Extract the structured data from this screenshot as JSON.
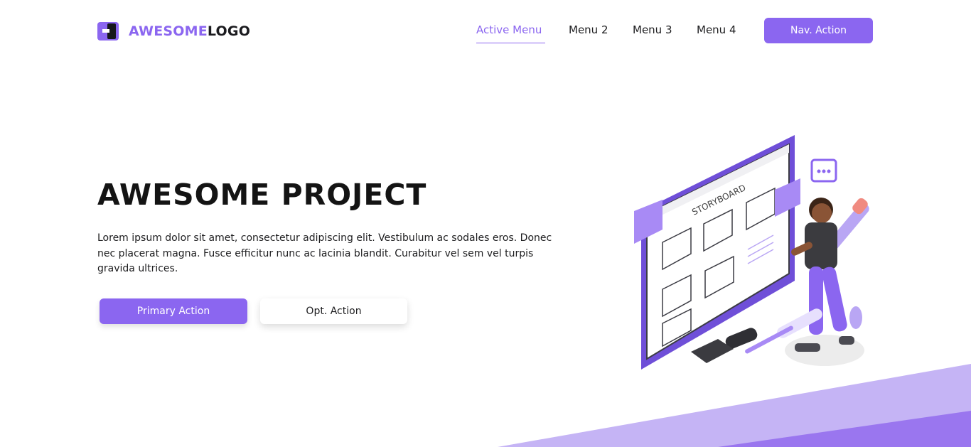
{
  "brand": {
    "logo_part1": "AWESOME",
    "logo_part2": "LOGO",
    "accent_color": "#8b66f0",
    "logo_icon": "logo-mark-icon"
  },
  "nav": {
    "items": [
      {
        "label": "Active Menu",
        "active": true
      },
      {
        "label": "Menu 2",
        "active": false
      },
      {
        "label": "Menu 3",
        "active": false
      },
      {
        "label": "Menu 4",
        "active": false
      }
    ],
    "action_label": "Nav. Action"
  },
  "hero": {
    "title": "AWESOME PROJECT",
    "text": "Lorem ipsum dolor sit amet, consectetur adipiscing elit. Vestibulum ac sodales eros. Donec nec placerat magna. Fusce efficitur nunc ac lacinia blandit. Curabitur vel sem vel turpis gravida ultrices.",
    "primary_label": "Primary Action",
    "secondary_label": "Opt. Action"
  },
  "illustration": {
    "board_title": "STORYBOARD",
    "icon": "storyboard-illustration"
  }
}
